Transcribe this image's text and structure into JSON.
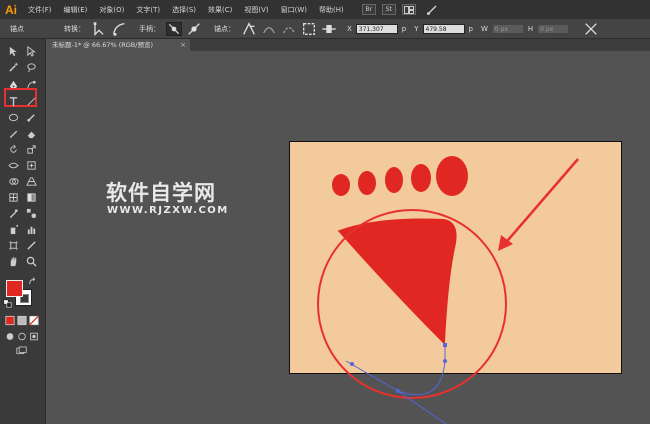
{
  "app": {
    "logo": "Ai"
  },
  "menu": {
    "items": [
      "文件(F)",
      "编辑(E)",
      "对象(O)",
      "文字(T)",
      "选择(S)",
      "效果(C)",
      "视图(V)",
      "窗口(W)",
      "帮助(H)"
    ],
    "bridge_label": "Br",
    "stock_label": "St"
  },
  "control_bar": {
    "mode_label": "锚点",
    "convert_label": "转换：",
    "handle_label": "手柄：",
    "anchor_label": "锚点：",
    "x_value": "371.307",
    "x_unit": "p",
    "y_value": "479.58",
    "y_unit": "p",
    "w_value": "0 px",
    "h_value": "0 px"
  },
  "document": {
    "tab_title": "未标题-1* @ 66.67% (RGB/预览)",
    "close_glyph": "×"
  },
  "watermark": {
    "text": "软件自学网",
    "url": "WWW.RJZXW.COM"
  },
  "colors": {
    "accent": "#e02721",
    "artboard": "#f2ca9c",
    "annotation": "#e8312f",
    "path": "#5566dd"
  },
  "icons": {
    "pen_tool": "pen-icon",
    "selection_tool": "arrow-icon",
    "fill": "fill-swatch",
    "stroke": "stroke-swatch"
  }
}
